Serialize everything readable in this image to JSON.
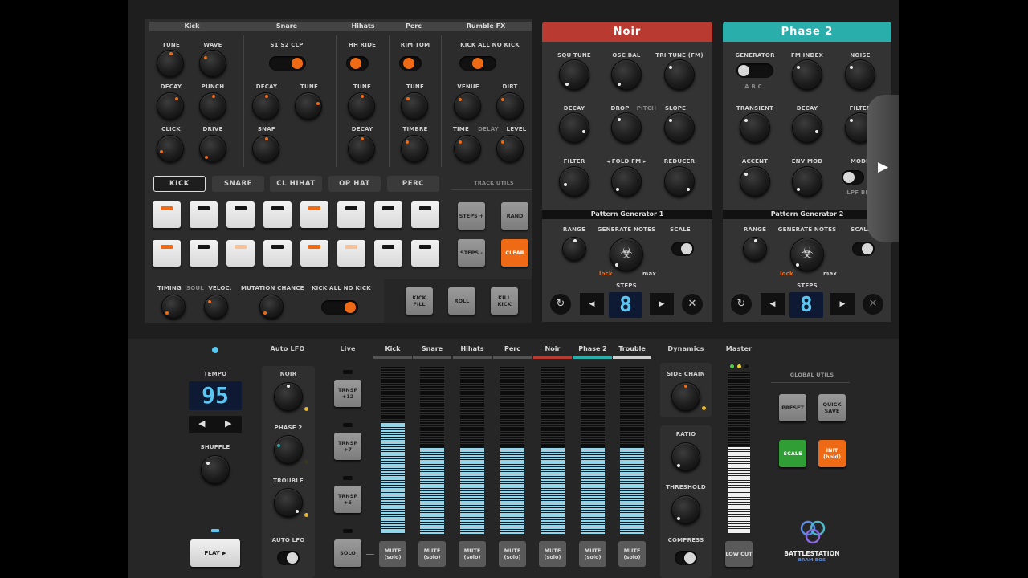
{
  "drums": {
    "headers": [
      "Kick",
      "Snare",
      "Hihats",
      "Perc",
      "Rumble FX"
    ],
    "kick": {
      "tune": "TUNE",
      "wave": "WAVE",
      "decay": "DECAY",
      "punch": "PUNCH",
      "click": "CLICK",
      "drive": "DRIVE"
    },
    "snare": {
      "modes": "S1   S2   CLP",
      "decay": "DECAY",
      "tune": "TUNE",
      "snap": "SNAP"
    },
    "hihats": {
      "modes": "HH  RIDE",
      "tune": "TUNE",
      "decay": "DECAY"
    },
    "perc": {
      "modes": "RIM  TOM",
      "tune": "TUNE",
      "timbre": "TIMBRE"
    },
    "rumble": {
      "modes": "KICK  ALL  NO KICK",
      "venue": "VENUE",
      "dirt": "DIRT",
      "time": "TIME",
      "delay": "DELAY",
      "level": "LEVEL"
    }
  },
  "tracks": [
    "KICK",
    "SNARE",
    "CL HIHAT",
    "OP HAT",
    "PERC"
  ],
  "track_utils": {
    "title": "TRACK UTILS",
    "steps_plus": "STEPS +",
    "rand": "RAND",
    "steps_minus": "STEPS -",
    "clear": "CLEAR"
  },
  "steps_row1": [
    "on",
    "off",
    "off",
    "off",
    "on",
    "off",
    "off",
    "off"
  ],
  "steps_row2": [
    "on",
    "off",
    "half",
    "off",
    "on",
    "half",
    "off",
    "off"
  ],
  "groove": {
    "timing": "TIMING",
    "soul": "SOUL",
    "veloc": "VELOC.",
    "mutation": "MUTATION CHANCE",
    "kick_modes": "KICK  ALL  NO KICK"
  },
  "fills": {
    "kick_fill": "KICK FILL",
    "roll": "ROLL",
    "kill_kick": "KILL KICK"
  },
  "noir": {
    "title": "Noir",
    "color": "#b83a31",
    "squ_tune": "SQU TUNE",
    "osc_bal": "OSC BAL",
    "tri_tune": "TRI TUNE (FM)",
    "decay": "DECAY",
    "drop": "DROP",
    "pitch": "PITCH",
    "slope": "SLOPE",
    "filter": "FILTER",
    "fold_fm": "◂ FOLD  FM ▸",
    "reducer": "REDUCER"
  },
  "phase2": {
    "title": "Phase 2",
    "color": "#2aaeac",
    "generator": "GENERATOR",
    "abc": "A   B   C",
    "fm_index": "FM INDEX",
    "noise": "NOISE",
    "transient": "TRANSIENT",
    "decay": "DECAY",
    "filter": "FILTER",
    "accent": "ACCENT",
    "env_mod": "ENV MOD",
    "mode": "MODE",
    "lpf": "LPF  BPF"
  },
  "pg1": {
    "title": "Pattern Generator 1",
    "range": "RANGE",
    "generate": "GENERATE NOTES",
    "scale": "SCALE",
    "lock": "lock",
    "max": "max",
    "steps": "STEPS",
    "steps_value": "8"
  },
  "pg2": {
    "title": "Pattern Generator 2",
    "range": "RANGE",
    "generate": "GENERATE NOTES",
    "scale": "SCALE",
    "lock": "lock",
    "max": "max",
    "steps": "STEPS",
    "steps_value": "8"
  },
  "transport": {
    "tempo_label": "TEMPO",
    "tempo": "95",
    "shuffle": "SHUFFLE",
    "play": "PLAY ▶"
  },
  "auto_lfo": {
    "title": "Auto LFO",
    "noir": "NOIR",
    "phase2": "PHASE 2",
    "trouble": "TROUBLE",
    "auto": "AUTO LFO"
  },
  "live": {
    "title": "Live",
    "t12": "TRNSP +12",
    "t7": "TRNSP +7",
    "t5": "TRNSP +5",
    "solo": "SOLO"
  },
  "mixer": {
    "channels": [
      {
        "name": "Kick",
        "level": 0.67,
        "color": "#555"
      },
      {
        "name": "Snare",
        "level": 0.52,
        "color": "#555"
      },
      {
        "name": "Hihats",
        "level": 0.52,
        "color": "#555"
      },
      {
        "name": "Perc",
        "level": 0.52,
        "color": "#555"
      },
      {
        "name": "Noir",
        "level": 0.52,
        "color": "#b83a31"
      },
      {
        "name": "Phase 2",
        "level": 0.52,
        "color": "#2aaeac"
      },
      {
        "name": "Trouble",
        "level": 0.52,
        "color": "#cfcfcf"
      }
    ],
    "mute": "MUTE (solo)"
  },
  "dynamics": {
    "title": "Dynamics",
    "side_chain": "SIDE CHAIN",
    "ratio": "RATIO",
    "threshold": "THRESHOLD",
    "compress": "COMPRESS"
  },
  "master": {
    "title": "Master",
    "level": 0.54,
    "low_cut": "LOW CUT"
  },
  "global_utils": {
    "title": "GLOBAL UTILS",
    "preset": "PRESET",
    "quick_save": "QUICK SAVE",
    "scale": "SCALE",
    "init": "INIT (hold)"
  },
  "brand": {
    "name": "BATTLESTATION",
    "sub": "BRAM BOS"
  }
}
